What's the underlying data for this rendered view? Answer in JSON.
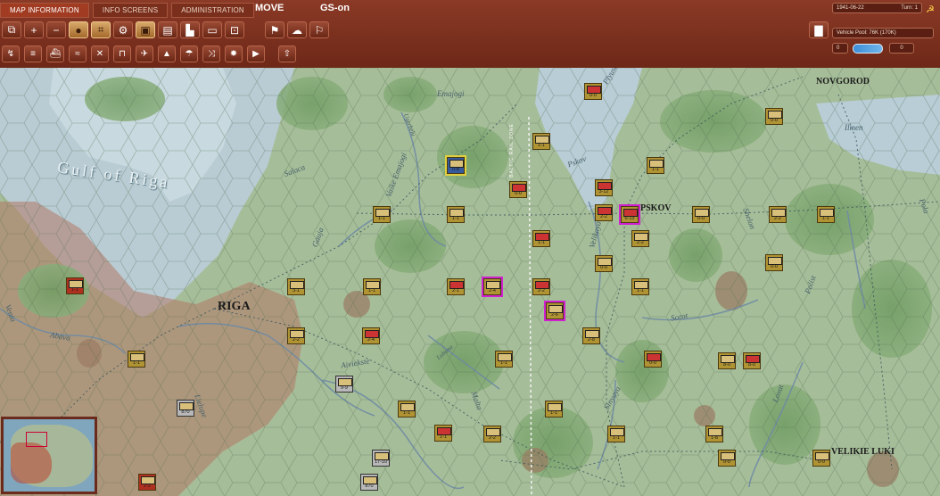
{
  "tabs": [
    {
      "label": "MAP INFORMATION",
      "active": true
    },
    {
      "label": "INFO SCREENS",
      "active": false
    },
    {
      "label": "ADMINISTRATION",
      "active": false
    }
  ],
  "mode_label": "MOVE",
  "gs_label": "GS-on",
  "info": {
    "date": "1941-06-22",
    "turn": "Turn: 1",
    "vehicle_pool": "Vehicle Pool: 76K (170K)",
    "counter_value": "0",
    "right_value": "0"
  },
  "map": {
    "gulf_label": "Gulf of Riga",
    "cities": [
      "Novgorod",
      "Pskov",
      "Riga",
      "Velikie Luki"
    ],
    "city_labels_display": [
      "NOVGOROD",
      "PSKOV",
      "RIGA",
      "VELIKIE LUKI"
    ],
    "waters": [
      "Ilmen",
      "Emajogi",
      "Salaca",
      "Gauja",
      "Abava",
      "Aiviekste",
      "Lubana",
      "Malta",
      "Sorot",
      "Sinyaya",
      "Lovat",
      "Polist",
      "Pola",
      "Shelon",
      "Velikaya",
      "Pskov",
      "Plyusa",
      "Lielupe",
      "Venta",
      "Vaike Emajogi",
      "Ugerbelu"
    ],
    "rail_label": "BALTIC RAIL ZONE"
  },
  "units": [
    {
      "str": "1-1"
    },
    {
      "str": "1-1"
    },
    {
      "str": "3-1"
    },
    {
      "str": "2-2"
    },
    {
      "str": "2-4"
    },
    {
      "str": "1-1"
    },
    {
      "str": "1-1"
    },
    {
      "str": "1-1"
    },
    {
      "str": "2-1"
    },
    {
      "str": "2-4"
    },
    {
      "str": "2-6"
    },
    {
      "str": "0-8"
    },
    {
      "str": "0-0"
    },
    {
      "str": "1-1"
    },
    {
      "str": "1-1"
    },
    {
      "str": "2-2"
    },
    {
      "str": "2-2"
    },
    {
      "str": "3-12"
    },
    {
      "str": "6-13"
    },
    {
      "str": "1-1"
    },
    {
      "str": "2-2"
    },
    {
      "str": "0-0"
    },
    {
      "str": "0-0"
    },
    {
      "str": "2-8"
    },
    {
      "str": "1-1"
    },
    {
      "str": "0-0"
    },
    {
      "str": "0-0"
    },
    {
      "str": "2-2"
    },
    {
      "str": "0-0"
    },
    {
      "str": "1-1"
    },
    {
      "str": "0-0"
    },
    {
      "str": "1-1"
    },
    {
      "str": "1-1"
    },
    {
      "str": "1-1"
    },
    {
      "str": "1-1"
    },
    {
      "str": "2-2"
    },
    {
      "str": "1-1"
    },
    {
      "str": "1-8"
    },
    {
      "str": "9-9"
    },
    {
      "str": "870"
    },
    {
      "str": "17-10"
    },
    {
      "str": "870"
    },
    {
      "str": "8-0"
    },
    {
      "str": "8-0"
    },
    {
      "str": "0-0"
    },
    {
      "str": "0-0"
    },
    {
      "str": "2-2"
    }
  ]
}
